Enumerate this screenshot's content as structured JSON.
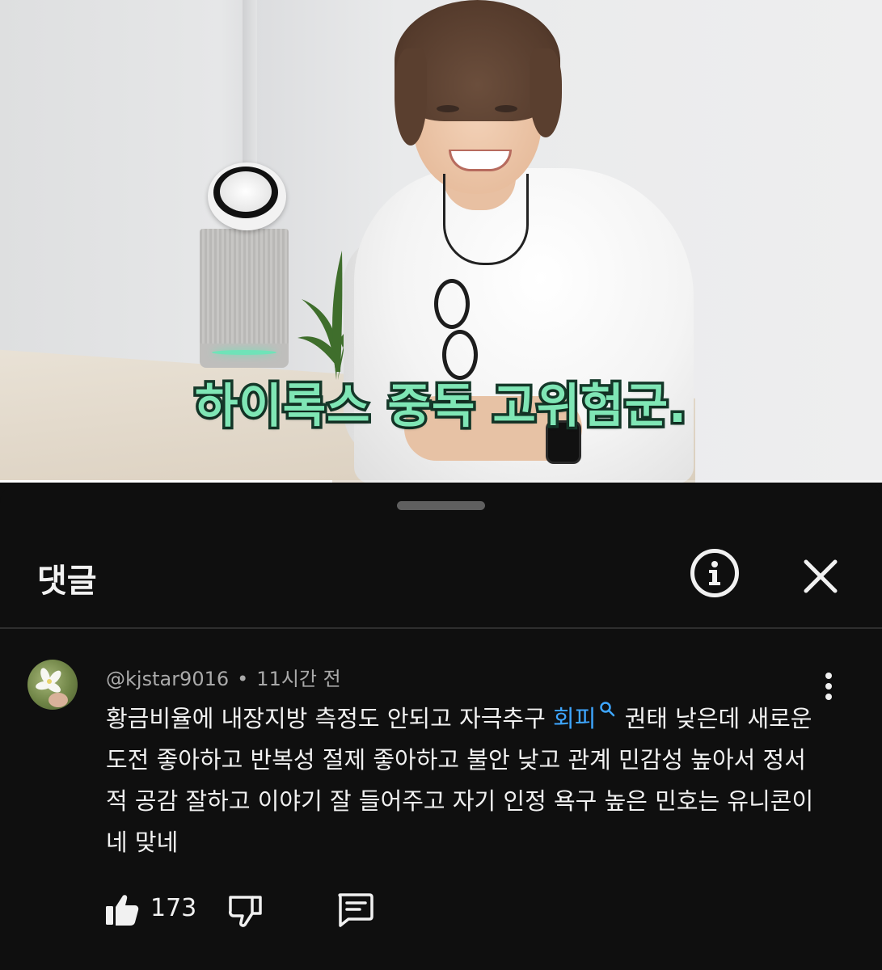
{
  "video": {
    "caption": "하이록스 중독 고위험군.",
    "progress_fraction": 0.377
  },
  "comments_panel": {
    "title": "댓글",
    "info_icon": "info-circle-icon",
    "close_icon": "close-icon"
  },
  "comment": {
    "author": "@kjstar9016",
    "separator": "•",
    "time": "11시간 전",
    "text_before_link": "황금비율에 내장지방 측정도 안되고 자극추구 ",
    "link_text": "회피",
    "text_after_link": " 권태 낮은데 새로운 도전 좋아하고 반복성 절제 좋아하고 불안 낮고 관계 민감성 높아서 정서적 공감 잘하고 이야기 잘 들어주고 자기 인정 욕구 높은 민호는 유니콘이네 맞네",
    "like_count": "173",
    "icons": {
      "like": "thumbs-up-icon",
      "dislike": "thumbs-down-icon",
      "reply": "reply-icon",
      "more": "more-vertical-icon",
      "search": "search-icon"
    },
    "colors": {
      "link": "#3ea6ff",
      "meta": "#aaaaaa"
    }
  }
}
